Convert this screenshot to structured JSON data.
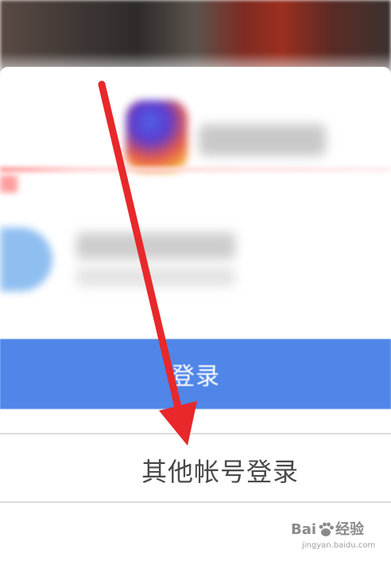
{
  "login_sheet": {
    "login_label": "登录",
    "other_login_label": "其他帐号登录"
  },
  "watermark": {
    "brand_left": "Bai",
    "brand_right": "经验",
    "domain": "jingyan.baidu.com"
  },
  "colors": {
    "login_button": "#4f86e8",
    "annotation_arrow": "#e8282b"
  }
}
